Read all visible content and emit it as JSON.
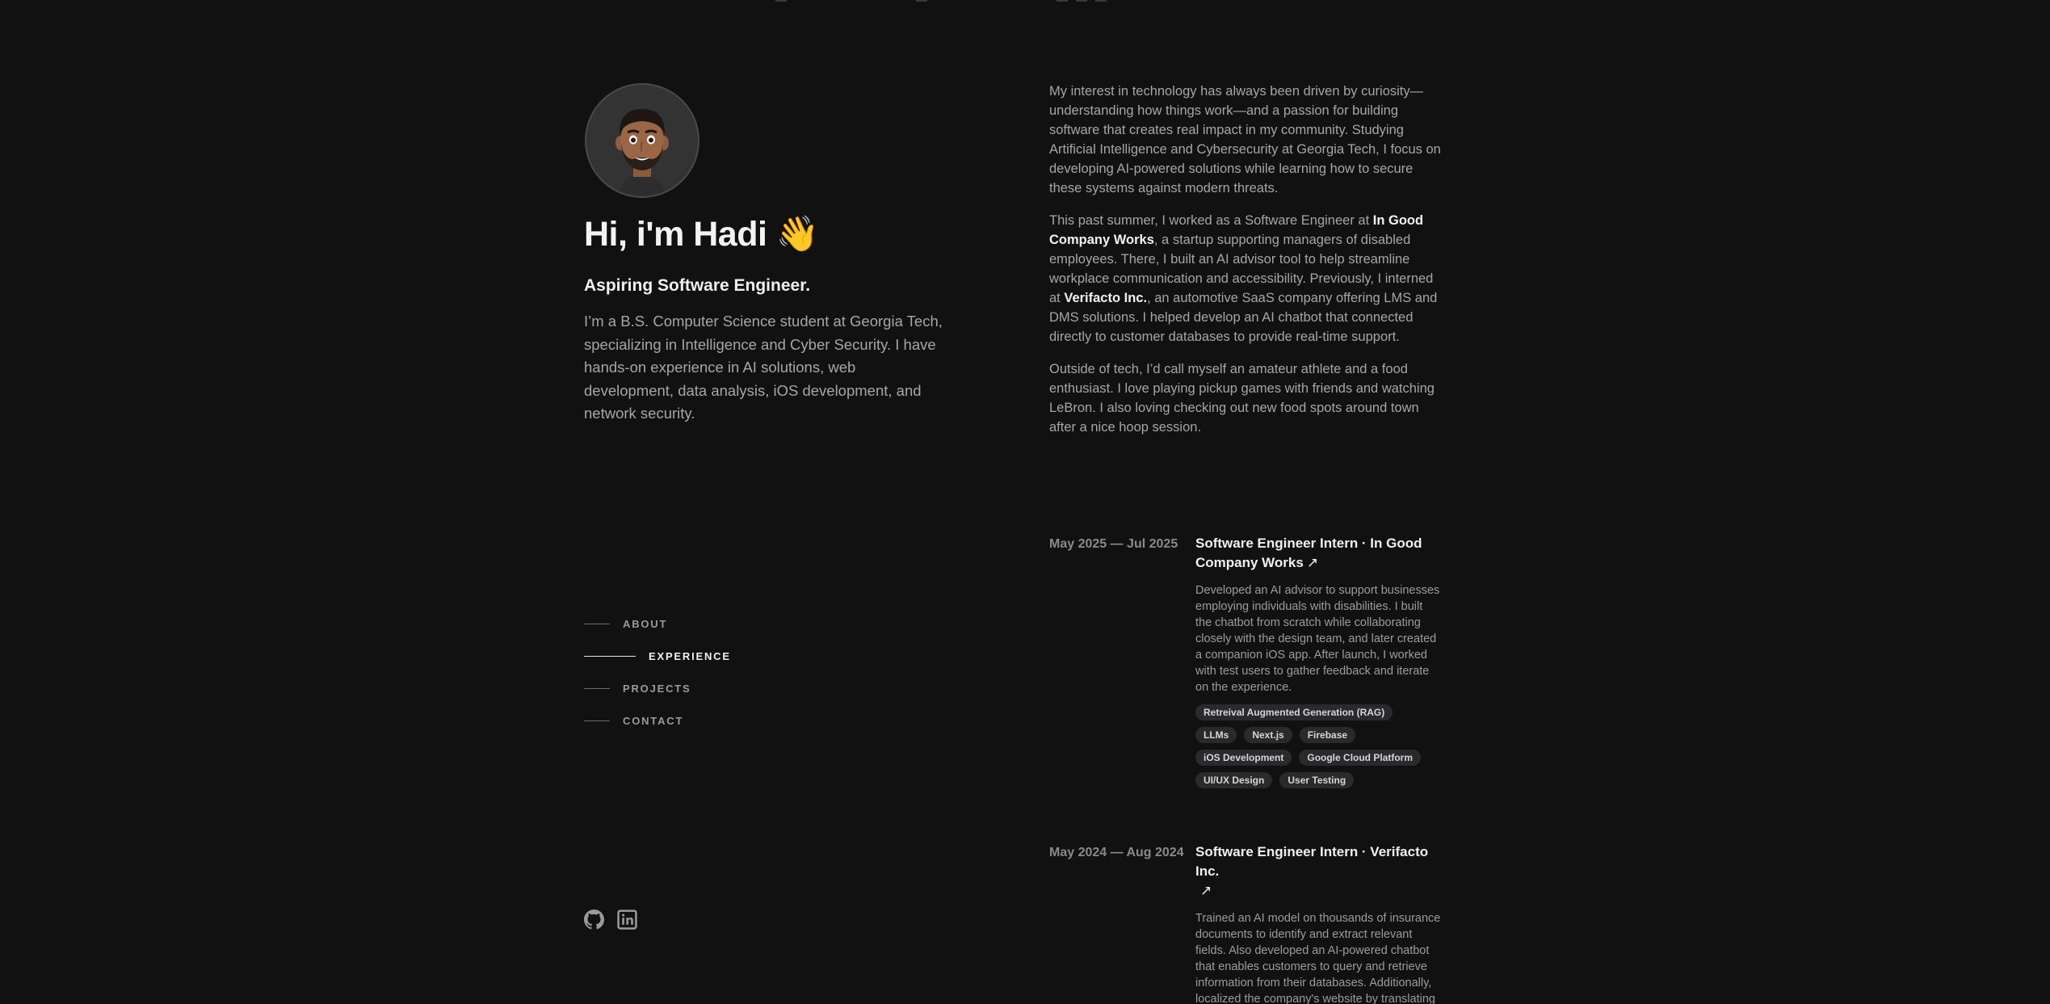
{
  "hero": {
    "name": "Hi, i'm Hadi 👋",
    "tagline": "Aspiring Software Engineer.",
    "intro": "I’m a B.S. Computer Science student at Georgia Tech, specializing in Intelligence and Cyber Security. I have hands-on experience in AI solutions, web development, data analysis, iOS development, and network security."
  },
  "nav": {
    "items": [
      {
        "label": "ABOUT",
        "active": false
      },
      {
        "label": "EXPERIENCE",
        "active": true
      },
      {
        "label": "PROJECTS",
        "active": false
      },
      {
        "label": "CONTACT",
        "active": false
      }
    ]
  },
  "socials": [
    "github-icon",
    "linkedin-icon"
  ],
  "about": {
    "p1": "My interest in technology has always been driven by curiosity—understanding how things work—and a passion for building software that creates real impact in my community. Studying Artificial Intelligence and Cybersecurity at Georgia Tech, I focus on developing AI-powered solutions while learning how to secure these systems against modern threats.",
    "p2_a": "This past summer, I worked as a Software Engineer at ",
    "p2_company1": "In Good Company Works",
    "p2_b": ", a startup supporting managers of disabled employees. There, I built an AI advisor tool to help streamline workplace communication and accessibility. Previously, I interned at ",
    "p2_company2": "Verifacto Inc.",
    "p2_c": ", an automotive SaaS company offering LMS and DMS solutions. I helped develop an AI chatbot that connected directly to customer databases to provide real-time support.",
    "p3": "Outside of tech, I’d call myself an amateur athlete and a food enthusiast. I love playing pickup games with friends and watching LeBron. I also loving checking out new food spots around town after a nice hoop session."
  },
  "experience": [
    {
      "date": "May 2025 — Jul 2025",
      "title": "Software Engineer Intern · In Good Company Works",
      "arrow": "↗",
      "description": "Developed an AI advisor to support businesses employing individuals with disabilities. I built the chatbot from scratch while collaborating closely with the design team, and later created a companion iOS app. After launch, I worked with test users to gather feedback and iterate on the experience.",
      "tags": [
        "Retreival Augmented Generation (RAG)",
        "LLMs",
        "Next.js",
        "Firebase",
        "iOS Development",
        "Google Cloud Platform",
        "UI/UX Design",
        "User Testing"
      ]
    },
    {
      "date": "May 2024 — Aug 2024",
      "title": "Software Engineer Intern · Verifacto Inc.",
      "arrow": "↗",
      "description": "Trained an AI model on thousands of insurance documents to identify and extract relevant fields. Also developed an AI-powered chatbot that enables customers to query and retrieve information from their databases. Additionally, localized the company's website by translating its content into Spanish.",
      "tags": []
    }
  ]
}
